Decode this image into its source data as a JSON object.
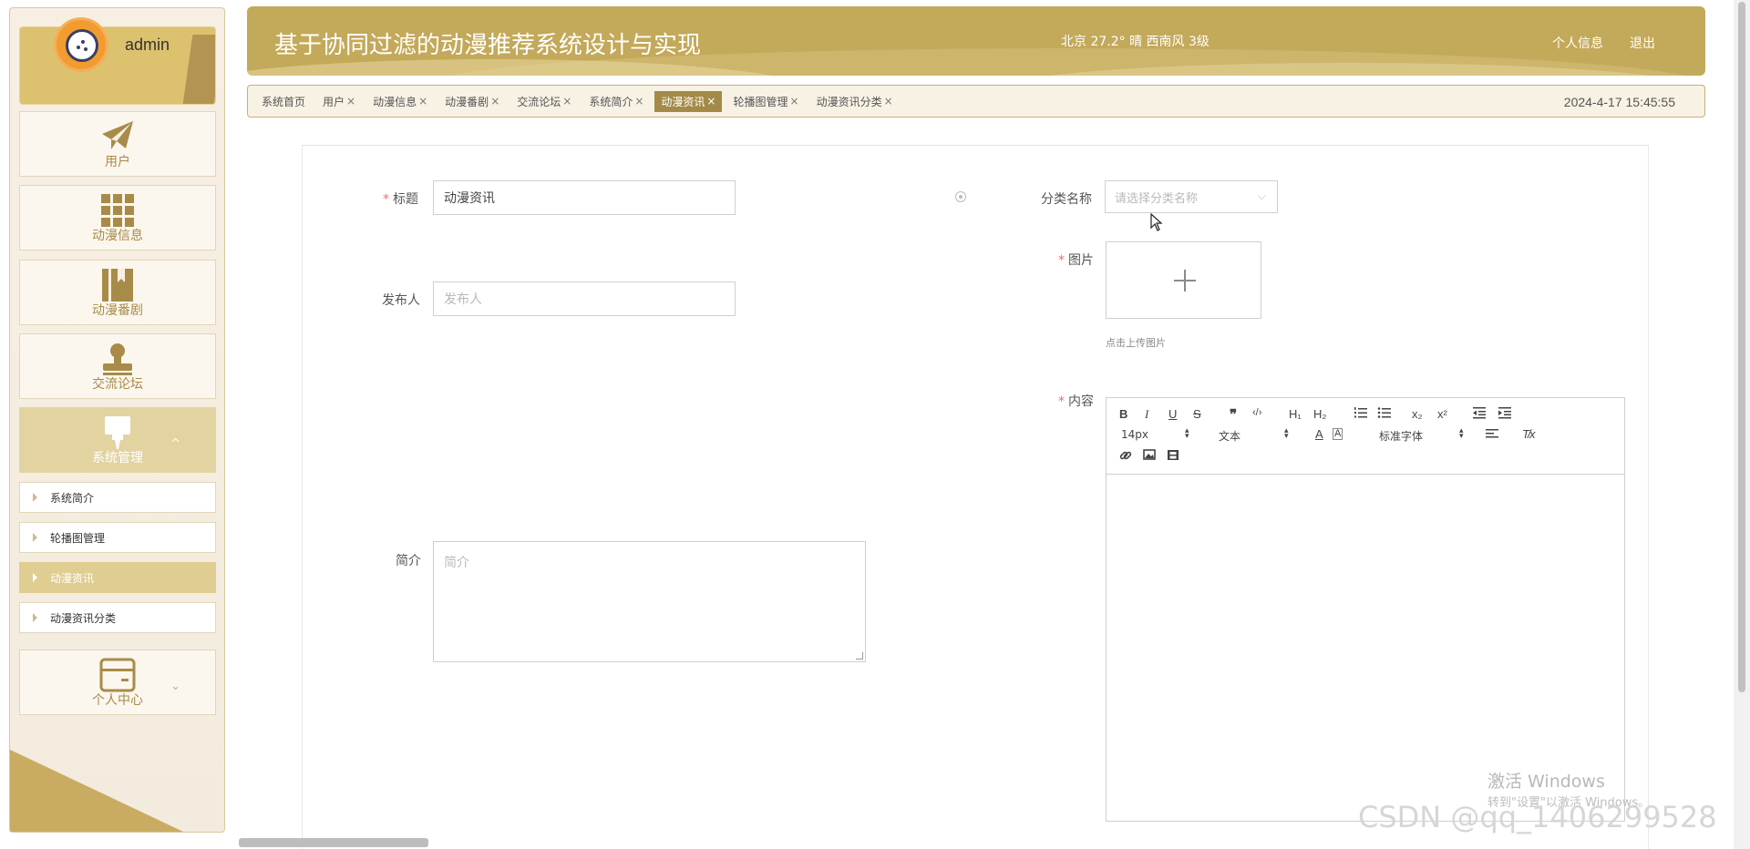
{
  "user": {
    "name": "admin"
  },
  "sidebar": {
    "menus": [
      {
        "label": "用户",
        "icon": "paper-plane-icon"
      },
      {
        "label": "动漫信息",
        "icon": "grid-icon"
      },
      {
        "label": "动漫番剧",
        "icon": "book-icon"
      },
      {
        "label": "交流论坛",
        "icon": "stamp-icon"
      },
      {
        "label": "系统管理",
        "icon": "paint-brush-icon"
      },
      {
        "label": "个人中心",
        "icon": "card-icon"
      }
    ],
    "submenus": [
      "系统简介",
      "轮播图管理",
      "动漫资讯",
      "动漫资讯分类"
    ],
    "expand_caret": "^",
    "collapse_caret": "⌄"
  },
  "header": {
    "title": "基于协同过滤的动漫推荐系统设计与实现",
    "weather": "北京  27.2°  晴  西南风  3级",
    "profile_link": "个人信息",
    "logout_link": "退出"
  },
  "tabs": [
    {
      "label": "系统首页",
      "closable": false
    },
    {
      "label": "用户",
      "closable": true
    },
    {
      "label": "动漫信息",
      "closable": true
    },
    {
      "label": "动漫番剧",
      "closable": true
    },
    {
      "label": "交流论坛",
      "closable": true
    },
    {
      "label": "系统简介",
      "closable": true
    },
    {
      "label": "动漫资讯",
      "closable": true,
      "active": true
    },
    {
      "label": "轮播图管理",
      "closable": true
    },
    {
      "label": "动漫资讯分类",
      "closable": true
    }
  ],
  "tab_close_char": "×",
  "datetime": "2024-4-17 15:45:55",
  "form": {
    "title_label": "标题",
    "title_value": "动漫资讯",
    "category_label": "分类名称",
    "category_placeholder": "请选择分类名称",
    "publisher_label": "发布人",
    "publisher_placeholder": "发布人",
    "image_label": "图片",
    "upload_tip": "点击上传图片",
    "summary_label": "简介",
    "summary_placeholder": "简介",
    "content_label": "内容",
    "required_mark": "*"
  },
  "editor": {
    "font_size": "14px",
    "header_select": "文本",
    "font_family": "标准字体",
    "tools": {
      "bold": "B",
      "italic": "I",
      "underline": "U",
      "strike": "S",
      "quote": "❞",
      "code": "‹/›",
      "h1": "H₁",
      "h2": "H₂",
      "subscript": "x₂",
      "superscript": "x²",
      "color": "A",
      "background": "A",
      "clean": "T̸x"
    }
  },
  "watermarks": {
    "win1": "激活 Windows",
    "win2": "转到\"设置\"以激活 Windows。",
    "csdn": "CSDN @qq_1406299528"
  },
  "colors": {
    "brand": "#c3a95a",
    "active": "#a38a48"
  }
}
